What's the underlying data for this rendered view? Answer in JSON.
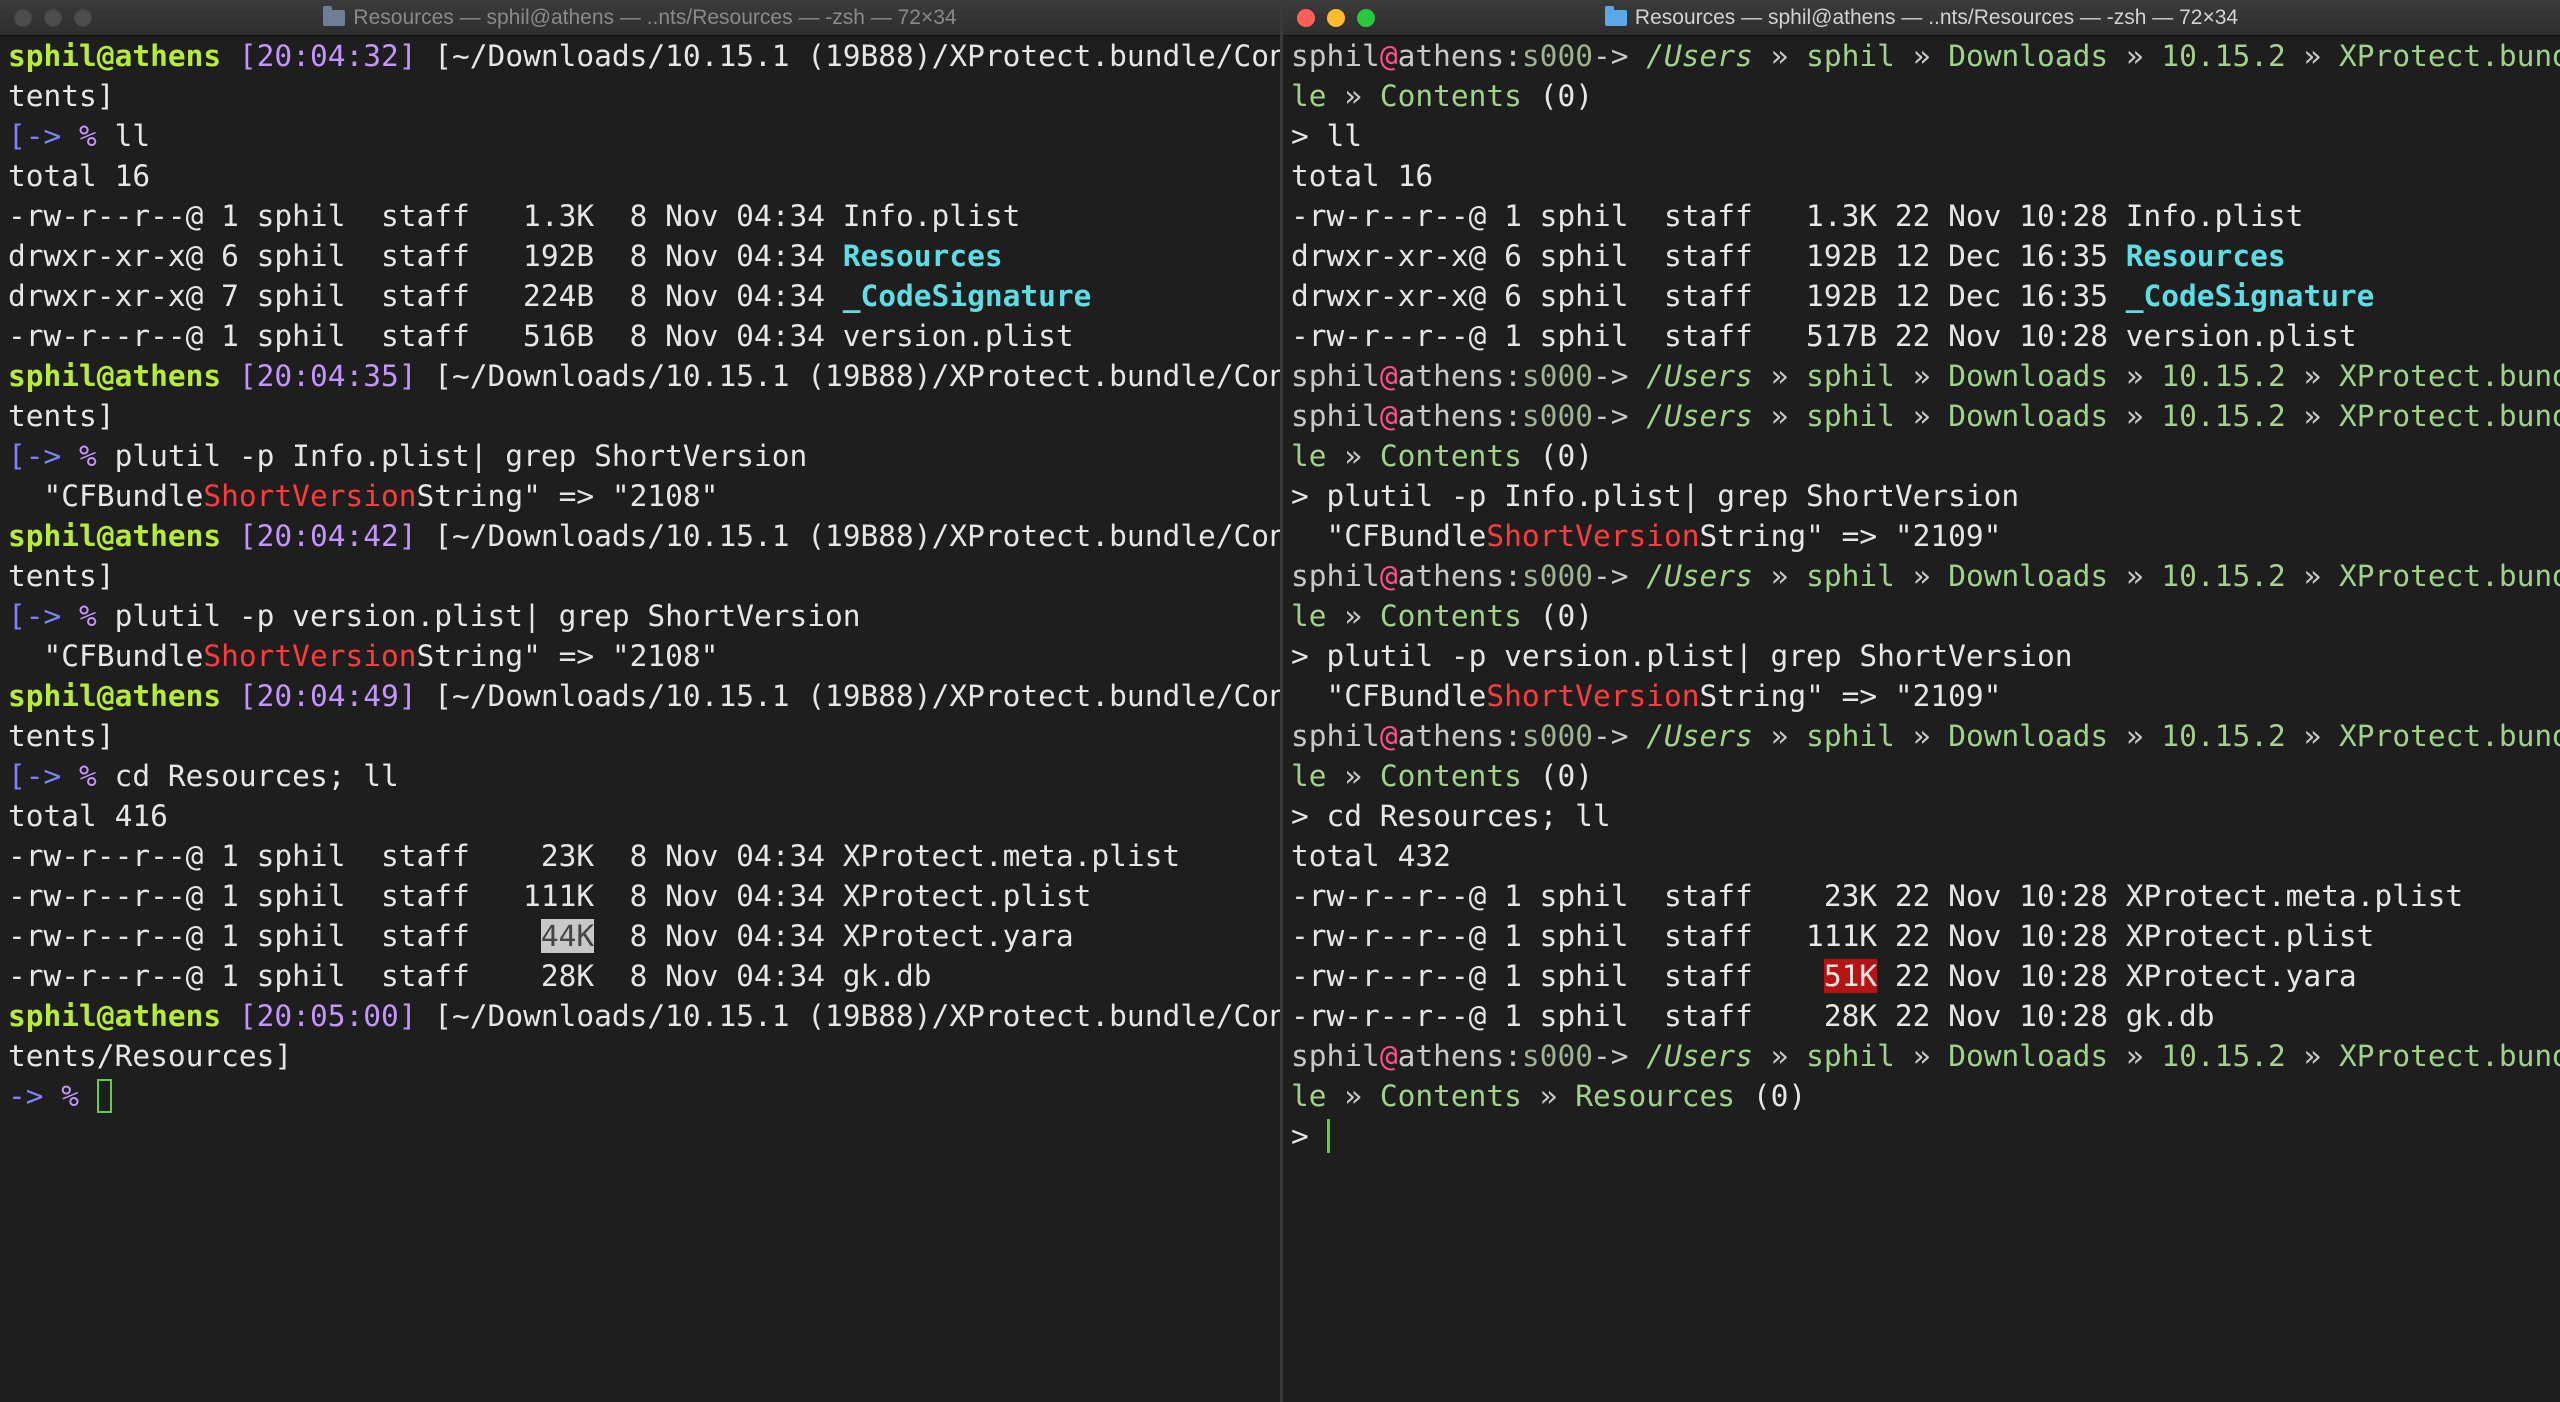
{
  "left_window": {
    "title": "Resources — sphil@athens — ..nts/Resources — -zsh — 72×34",
    "lines": [
      [
        [
          "sphil@athens",
          "g"
        ],
        [
          " ",
          "w"
        ],
        [
          "[20:04:32]",
          "pu"
        ],
        [
          " [~/Downloads/10.15.1 (19B88)/XProtect.bundle/Con",
          "w"
        ]
      ],
      [
        [
          "tents]",
          "w"
        ]
      ],
      [
        [
          "[-> ",
          "bl"
        ],
        [
          "% ",
          "pu"
        ],
        [
          "ll",
          "w"
        ]
      ],
      [
        [
          "total 16",
          "w"
        ]
      ],
      [
        [
          "-rw-r--r--@ 1 sphil  staff   1.3K  8 Nov 04:34 Info.plist",
          "w"
        ]
      ],
      [
        [
          "drwxr-xr-x@ 6 sphil  staff   192B  8 Nov 04:34 ",
          "w"
        ],
        [
          "Resources",
          "cy"
        ]
      ],
      [
        [
          "drwxr-xr-x@ 7 sphil  staff   224B  8 Nov 04:34 ",
          "w"
        ],
        [
          "_CodeSignature",
          "cy"
        ]
      ],
      [
        [
          "-rw-r--r--@ 1 sphil  staff   516B  8 Nov 04:34 version.plist",
          "w"
        ]
      ],
      [
        [
          "sphil@athens",
          "g"
        ],
        [
          " ",
          "w"
        ],
        [
          "[20:04:35]",
          "pu"
        ],
        [
          " [~/Downloads/10.15.1 (19B88)/XProtect.bundle/Con",
          "w"
        ]
      ],
      [
        [
          "tents]",
          "w"
        ]
      ],
      [
        [
          "[-> ",
          "bl"
        ],
        [
          "% ",
          "pu"
        ],
        [
          "plutil -p Info.plist| grep ShortVersion",
          "w"
        ]
      ],
      [
        [
          "  \"CFBundle",
          "w"
        ],
        [
          "ShortVersion",
          "rd"
        ],
        [
          "String\" => \"2108\"",
          "w"
        ]
      ],
      [
        [
          "sphil@athens",
          "g"
        ],
        [
          " ",
          "w"
        ],
        [
          "[20:04:42]",
          "pu"
        ],
        [
          " [~/Downloads/10.15.1 (19B88)/XProtect.bundle/Con",
          "w"
        ]
      ],
      [
        [
          "tents]",
          "w"
        ]
      ],
      [
        [
          "[-> ",
          "bl"
        ],
        [
          "% ",
          "pu"
        ],
        [
          "plutil -p version.plist| grep ShortVersion",
          "w"
        ]
      ],
      [
        [
          "  \"CFBundle",
          "w"
        ],
        [
          "ShortVersion",
          "rd"
        ],
        [
          "String\" => \"2108\"",
          "w"
        ]
      ],
      [
        [
          "sphil@athens",
          "g"
        ],
        [
          " ",
          "w"
        ],
        [
          "[20:04:49]",
          "pu"
        ],
        [
          " [~/Downloads/10.15.1 (19B88)/XProtect.bundle/Con",
          "w"
        ]
      ],
      [
        [
          "tents]",
          "w"
        ]
      ],
      [
        [
          "[-> ",
          "bl"
        ],
        [
          "% ",
          "pu"
        ],
        [
          "cd Resources; ll",
          "w"
        ]
      ],
      [
        [
          "total 416",
          "w"
        ]
      ],
      [
        [
          "-rw-r--r--@ 1 sphil  staff    23K  8 Nov 04:34 XProtect.meta.plist",
          "w"
        ]
      ],
      [
        [
          "-rw-r--r--@ 1 sphil  staff   111K  8 Nov 04:34 XProtect.plist",
          "w"
        ]
      ],
      [
        [
          "-rw-r--r--@ 1 sphil  staff    ",
          "w"
        ],
        [
          "44K",
          "hl"
        ],
        [
          "  8 Nov 04:34 XProtect.yara",
          "w"
        ]
      ],
      [
        [
          "-rw-r--r--@ 1 sphil  staff    28K  8 Nov 04:34 gk.db",
          "w"
        ]
      ],
      [
        [
          "sphil@athens",
          "g"
        ],
        [
          " ",
          "w"
        ],
        [
          "[20:05:00]",
          "pu"
        ],
        [
          " [~/Downloads/10.15.1 (19B88)/XProtect.bundle/Con",
          "w"
        ]
      ],
      [
        [
          "tents/Resources]",
          "w"
        ]
      ],
      [
        [
          "-> ",
          "bl"
        ],
        [
          "% ",
          "pu"
        ]
      ]
    ]
  },
  "right_window": {
    "title": "Resources — sphil@athens — ..nts/Resources — -zsh — 72×34",
    "lines": [
      [
        [
          "sphil",
          "cm"
        ],
        [
          "@",
          "pk"
        ],
        [
          "athens",
          "cm"
        ],
        [
          ":",
          "cm"
        ],
        [
          "s000",
          "gr"
        ],
        [
          "-> ",
          "cm"
        ],
        [
          "/Users",
          "gn it"
        ],
        [
          " » ",
          "cm"
        ],
        [
          "sphil",
          "gn"
        ],
        [
          " » ",
          "cm"
        ],
        [
          "Downloads",
          "gn"
        ],
        [
          " » ",
          "cm"
        ],
        [
          "10.15.2",
          "gn"
        ],
        [
          " » ",
          "cm"
        ],
        [
          "XProtect.bund",
          "gn"
        ]
      ],
      [
        [
          "le",
          "gn"
        ],
        [
          " » ",
          "cm"
        ],
        [
          "Contents",
          "gn"
        ],
        [
          " (0)",
          "w"
        ]
      ],
      [
        [
          "> ll",
          "w"
        ]
      ],
      [
        [
          "total 16",
          "w"
        ]
      ],
      [
        [
          "-rw-r--r--@ 1 sphil  staff   1.3K 22 Nov 10:28 Info.plist",
          "w"
        ]
      ],
      [
        [
          "drwxr-xr-x@ 6 sphil  staff   192B 12 Dec 16:35 ",
          "w"
        ],
        [
          "Resources",
          "cy"
        ]
      ],
      [
        [
          "drwxr-xr-x@ 6 sphil  staff   192B 12 Dec 16:35 ",
          "w"
        ],
        [
          "_CodeSignature",
          "cy"
        ]
      ],
      [
        [
          "-rw-r--r--@ 1 sphil  staff   517B 22 Nov 10:28 version.plist",
          "w"
        ]
      ],
      [
        [
          "sphil",
          "cm"
        ],
        [
          "@",
          "pk"
        ],
        [
          "athens",
          "cm"
        ],
        [
          ":",
          "cm"
        ],
        [
          "s000",
          "gr"
        ],
        [
          "-> ",
          "cm"
        ],
        [
          "/Users",
          "gn it"
        ],
        [
          " » ",
          "cm"
        ],
        [
          "sphil",
          "gn"
        ],
        [
          " » ",
          "cm"
        ],
        [
          "Downloads",
          "gn"
        ],
        [
          " » ",
          "cm"
        ],
        [
          "10.15.2",
          "gn"
        ],
        [
          " » ",
          "cm"
        ],
        [
          "XProtect.bund",
          "gn"
        ]
      ],
      [
        [
          "sphil",
          "cm"
        ],
        [
          "@",
          "pk"
        ],
        [
          "athens",
          "cm"
        ],
        [
          ":",
          "cm"
        ],
        [
          "s000",
          "gr"
        ],
        [
          "-> ",
          "cm"
        ],
        [
          "/Users",
          "gn it"
        ],
        [
          " » ",
          "cm"
        ],
        [
          "sphil",
          "gn"
        ],
        [
          " » ",
          "cm"
        ],
        [
          "Downloads",
          "gn"
        ],
        [
          " » ",
          "cm"
        ],
        [
          "10.15.2",
          "gn"
        ],
        [
          " » ",
          "cm"
        ],
        [
          "XProtect.bund",
          "gn"
        ]
      ],
      [
        [
          "le",
          "gn"
        ],
        [
          " » ",
          "cm"
        ],
        [
          "Contents",
          "gn"
        ],
        [
          " (0)",
          "w"
        ]
      ],
      [
        [
          "> plutil -p Info.plist| grep ShortVersion",
          "w"
        ]
      ],
      [
        [
          "  \"CFBundle",
          "w"
        ],
        [
          "ShortVersion",
          "rd"
        ],
        [
          "String\" => \"2109\"",
          "w"
        ]
      ],
      [
        [
          "sphil",
          "cm"
        ],
        [
          "@",
          "pk"
        ],
        [
          "athens",
          "cm"
        ],
        [
          ":",
          "cm"
        ],
        [
          "s000",
          "gr"
        ],
        [
          "-> ",
          "cm"
        ],
        [
          "/Users",
          "gn it"
        ],
        [
          " » ",
          "cm"
        ],
        [
          "sphil",
          "gn"
        ],
        [
          " » ",
          "cm"
        ],
        [
          "Downloads",
          "gn"
        ],
        [
          " » ",
          "cm"
        ],
        [
          "10.15.2",
          "gn"
        ],
        [
          " » ",
          "cm"
        ],
        [
          "XProtect.bund",
          "gn"
        ]
      ],
      [
        [
          "le",
          "gn"
        ],
        [
          " » ",
          "cm"
        ],
        [
          "Contents",
          "gn"
        ],
        [
          " (0)",
          "w"
        ]
      ],
      [
        [
          "> plutil -p version.plist| grep ShortVersion",
          "w"
        ]
      ],
      [
        [
          "  \"CFBundle",
          "w"
        ],
        [
          "ShortVersion",
          "rd"
        ],
        [
          "String\" => \"2109\"",
          "w"
        ]
      ],
      [
        [
          "sphil",
          "cm"
        ],
        [
          "@",
          "pk"
        ],
        [
          "athens",
          "cm"
        ],
        [
          ":",
          "cm"
        ],
        [
          "s000",
          "gr"
        ],
        [
          "-> ",
          "cm"
        ],
        [
          "/Users",
          "gn it"
        ],
        [
          " » ",
          "cm"
        ],
        [
          "sphil",
          "gn"
        ],
        [
          " » ",
          "cm"
        ],
        [
          "Downloads",
          "gn"
        ],
        [
          " » ",
          "cm"
        ],
        [
          "10.15.2",
          "gn"
        ],
        [
          " » ",
          "cm"
        ],
        [
          "XProtect.bund",
          "gn"
        ]
      ],
      [
        [
          "le",
          "gn"
        ],
        [
          " » ",
          "cm"
        ],
        [
          "Contents",
          "gn"
        ],
        [
          " (0)",
          "w"
        ]
      ],
      [
        [
          "> cd Resources; ll",
          "w"
        ]
      ],
      [
        [
          "total 432",
          "w"
        ]
      ],
      [
        [
          "-rw-r--r--@ 1 sphil  staff    23K 22 Nov 10:28 XProtect.meta.plist",
          "w"
        ]
      ],
      [
        [
          "-rw-r--r--@ 1 sphil  staff   111K 22 Nov 10:28 XProtect.plist",
          "w"
        ]
      ],
      [
        [
          "-rw-r--r--@ 1 sphil  staff    ",
          "w"
        ],
        [
          "51K",
          "hlr"
        ],
        [
          " 22 Nov 10:28 XProtect.yara",
          "w"
        ]
      ],
      [
        [
          "-rw-r--r--@ 1 sphil  staff    28K 22 Nov 10:28 gk.db",
          "w"
        ]
      ],
      [
        [
          "sphil",
          "cm"
        ],
        [
          "@",
          "pk"
        ],
        [
          "athens",
          "cm"
        ],
        [
          ":",
          "cm"
        ],
        [
          "s000",
          "gr"
        ],
        [
          "-> ",
          "cm"
        ],
        [
          "/Users",
          "gn it"
        ],
        [
          " » ",
          "cm"
        ],
        [
          "sphil",
          "gn"
        ],
        [
          " » ",
          "cm"
        ],
        [
          "Downloads",
          "gn"
        ],
        [
          " » ",
          "cm"
        ],
        [
          "10.15.2",
          "gn"
        ],
        [
          " » ",
          "cm"
        ],
        [
          "XProtect.bund",
          "gn"
        ]
      ],
      [
        [
          "le",
          "gn"
        ],
        [
          " » ",
          "cm"
        ],
        [
          "Contents",
          "gn"
        ],
        [
          " » ",
          "cm"
        ],
        [
          "Resources",
          "gn"
        ],
        [
          " (0)",
          "w"
        ]
      ],
      [
        [
          "> ",
          "w"
        ]
      ]
    ]
  },
  "colors": {
    "background": "#1e1e1e",
    "prompt_user": "#b7ec3a",
    "prompt_time": "#c495ff",
    "prompt_arrow": "#7e82ff",
    "directory": "#5fdde5",
    "match": "#ff3b3b",
    "path": "#9fd38a",
    "at_sign": "#ff4f8b",
    "cursor": "#5ed23e",
    "highlight_diff": "#b51414"
  }
}
